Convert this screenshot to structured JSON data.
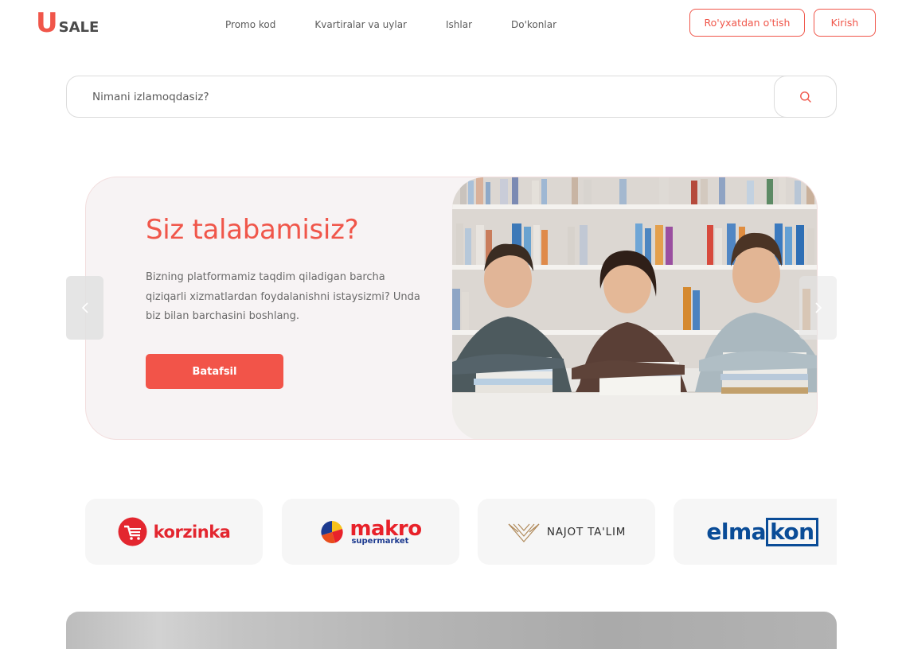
{
  "header": {
    "logo_u": "U",
    "logo_sale": "SALE",
    "nav": [
      "Promo kod",
      "Kvartiralar va uylar",
      "Ishlar",
      "Do'konlar"
    ],
    "register_label": "Ro'yxatdan o'tish",
    "login_label": "Kirish"
  },
  "search": {
    "placeholder": "Nimani izlamoqdasiz?"
  },
  "hero": {
    "title": "Siz talabamisiz?",
    "text": "Bizning platformamiz taqdim qiladigan barcha qiziqarli xizmatlardan foydalanishni istaysizmi? Unda biz bilan barchasini boshlang.",
    "button_label": "Batafsil"
  },
  "partners": [
    {
      "name": "korzinka"
    },
    {
      "name": "makro",
      "sub": "supermarket"
    },
    {
      "name": "NAJOT TA'LIM"
    },
    {
      "name_part1": "elma",
      "name_part2": "kon"
    }
  ],
  "colors": {
    "accent": "#f0564a",
    "hero_bg": "#f7f3f4",
    "korzinka": "#e3262f",
    "makro_blue": "#1c3a8f",
    "elmakon": "#0a4c97"
  }
}
